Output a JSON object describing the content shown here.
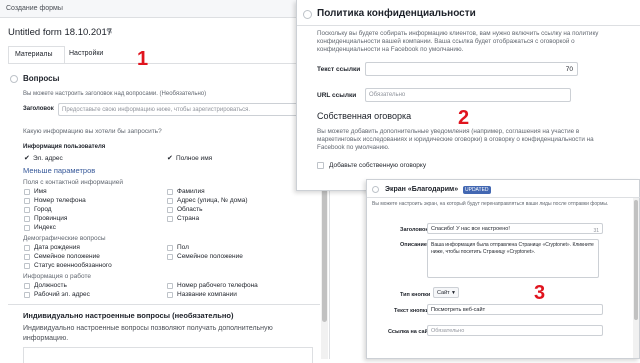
{
  "panel1": {
    "header": "Создание формы",
    "form_title": "Untitled form 18.10.2017",
    "tabs": [
      "Материалы",
      "Настройки"
    ],
    "questions_title": "Вопросы",
    "questions_desc": "Вы можете настроить заголовок над вопросами. (Необязательно)",
    "headline_label": "Заголовок",
    "headline_placeholder": "Предоставьте свою информацию ниже, чтобы зарегистрироваться.",
    "ask_label": "Какую информацию вы хотели бы запросить?",
    "user_info_label": "Информация пользователя",
    "email_label": "Эл. адрес",
    "fullname_label": "Полное имя",
    "fewer_params": "Меньше параметров",
    "contact_group": "Поля с контактной информацией",
    "contact_fields": [
      "Имя",
      "Номер телефона",
      "Город",
      "Провинция",
      "Индекс"
    ],
    "contact_fields_right": [
      "Фамилия",
      "Адрес (улица, № дома)",
      "Область",
      "Страна"
    ],
    "demo_group": "Демографические вопросы",
    "demo_fields": [
      "Дата рождения",
      "Семейное положение",
      "Статус военнообязанного"
    ],
    "demo_fields_right": [
      "Пол",
      "Семейное положение"
    ],
    "work_group": "Информация о работе",
    "work_fields": [
      "Должность",
      "Рабочий эл. адрес"
    ],
    "work_fields_right": [
      "Номер рабочего телефона",
      "Название компании"
    ],
    "custom_title": "Индивидуально настроенные вопросы (необязательно)",
    "custom_desc": "Индивидуально настроенные вопросы позволяют получать дополнительную информацию."
  },
  "panel2": {
    "title": "Политика конфиденциальности",
    "desc": "Поскольку вы будете собирать информацию клиентов, вам нужно включить ссылку на политику конфиденциальности вашей компании. Ваша ссылка будет отображаться с оговоркой о конфиденциальности на Facebook по умолчанию.",
    "link_text_label": "Текст ссылки",
    "link_text_counter": "70",
    "url_label": "URL ссылки",
    "url_placeholder": "Обязательно",
    "disclaimer_title": "Собственная оговорка",
    "disclaimer_desc": "Вы можете добавить дополнительные уведомления (например, соглашения на участие в маркетинговых исследованиях и юридические оговорки) в оговорку о конфиденциальности на Facebook по умолчанию.",
    "add_disclaimer_label": "Добавьте собственную оговорку"
  },
  "panel3": {
    "title": "Экран «Благодарим»",
    "badge": "UPDATED",
    "desc": "Вы можете настроить экран, на который будут перенаправляться ваши лиды после отправки формы.",
    "headline_label": "Заголовок",
    "headline_value": "Спасибо! У нас все настроено!",
    "headline_counter": "31",
    "description_label": "Описание",
    "description_value": "Ваша информация была отправлена Странице «Cryptonet». Кликните ниже, чтобы посетить Страницу «Cryptonet».",
    "button_type_label": "Тип кнопки",
    "button_type_value": "Сайт",
    "button_text_label": "Текст кнопки",
    "button_text_value": "Посмотреть веб-сайт",
    "site_link_label": "Ссылка на сайт",
    "site_link_placeholder": "Обязательно"
  },
  "annotations": [
    "1",
    "2",
    "3"
  ]
}
